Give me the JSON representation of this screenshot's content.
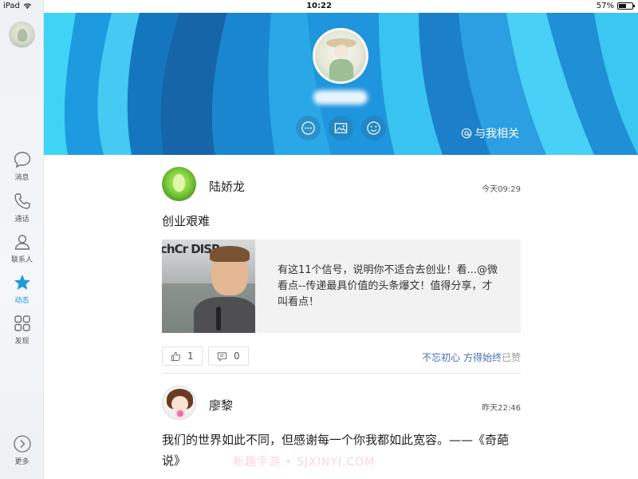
{
  "status_bar": {
    "device": "iPad",
    "time": "10:22",
    "battery": "57%",
    "battery_level": 0.57
  },
  "sidebar": {
    "items": [
      {
        "label": "消息",
        "icon": "chat-bubble-icon",
        "active": false
      },
      {
        "label": "通话",
        "icon": "phone-icon",
        "active": false
      },
      {
        "label": "联系人",
        "icon": "contacts-icon",
        "active": false
      },
      {
        "label": "动态",
        "icon": "star-icon",
        "active": true
      },
      {
        "label": "发现",
        "icon": "grid-icon",
        "active": false
      }
    ],
    "more_label": "更多"
  },
  "header": {
    "profile_name": "",
    "actions": [
      "message-icon",
      "photo-icon",
      "emoji-icon"
    ],
    "mention_label": "与我相关",
    "colors": {
      "stripe_dark": "#1565a8",
      "stripe_mid": "#1e9be0",
      "stripe_light": "#3fd4f5"
    }
  },
  "feed": {
    "posts": [
      {
        "author": "陆娇龙",
        "time": "今天09:29",
        "text": "创业艰难",
        "link_card": {
          "thumb_text": "chCr DISR",
          "description": "有这11个信号，说明你不适合去创业！看...@微看点--传递最具价值的头条爆文！值得分享，才叫看点！"
        },
        "like_count": "1",
        "comment_count": "0",
        "liked_by": "不忘初心 方得始终",
        "liked_suffix": "已赞"
      },
      {
        "author": "廖黎",
        "time": "昨天22:46",
        "text": "我们的世界如此不同，但感谢每一个你我都如此宽容。——《奇葩说》"
      }
    ]
  },
  "watermark": "新趣手游 • SJXINYI.COM",
  "accent_color": "#1f9bd9",
  "link_color": "#4a6db5"
}
